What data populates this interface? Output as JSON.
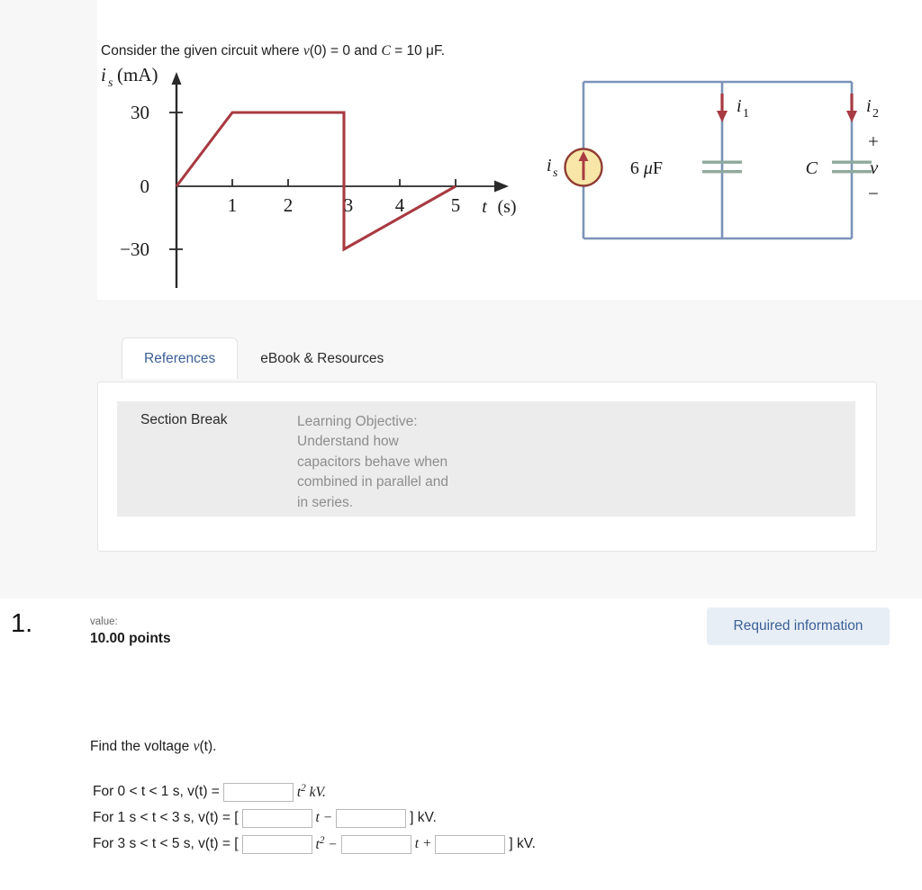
{
  "stimulus": {
    "prompt_prefix": "Consider the given circuit where ",
    "prompt_v0": "v",
    "prompt_mid": "(0) = 0 and ",
    "prompt_c": "C",
    "prompt_suffix": " = 10 μF."
  },
  "chart_data": {
    "type": "line",
    "title": "",
    "ylabel": "i_s (mA)",
    "ylabel_symbol": "i",
    "ylabel_sub": "s",
    "ylabel_unit": "(mA)",
    "xlabel": "t(s)",
    "xlabel_symbol": "t",
    "xlabel_unit": "(s)",
    "xlim": [
      0,
      5.6
    ],
    "ylim": [
      -45,
      42
    ],
    "xticks": [
      1,
      2,
      3,
      4,
      5
    ],
    "xtick_labels": [
      "1",
      "2",
      "3",
      "4",
      "5"
    ],
    "yticks": [
      30,
      0,
      -30
    ],
    "ytick_labels": [
      "30",
      "0",
      "−30"
    ],
    "grid": false,
    "legend": false,
    "series_color": "#a83a42",
    "series": [
      {
        "name": "i_s(t)",
        "points": [
          {
            "t": 0,
            "i": 0
          },
          {
            "t": 1,
            "i": 30
          },
          {
            "t": 3,
            "i": 30
          },
          {
            "t": 3,
            "i": -30
          },
          {
            "t": 5,
            "i": 0
          }
        ]
      }
    ],
    "description": "Piecewise source current: ramps 0 to 30 mA over 0<t<1 s, holds 30 mA for 1<t<3 s, steps down to -30 mA at t=3 s, then ramps linearly back to 0 at t=5 s."
  },
  "circuit": {
    "source_label": "i",
    "source_sub": "s",
    "branch1_current": "i",
    "branch1_sub": "1",
    "branch2_current": "i",
    "branch2_sub": "2",
    "cap1_label": "6 μF",
    "cap2_label": "C",
    "voltage_label": "v",
    "plus_sign": "+",
    "minus_sign": "−",
    "wire_color": "#7b93b8",
    "arrow_color": "#a83a42",
    "source_fill": "#f7e6a8",
    "plate_color": "#8fa99c"
  },
  "tabs": [
    {
      "label": "References",
      "active": true
    },
    {
      "label": "eBook & Resources",
      "active": false
    }
  ],
  "section_break": {
    "title": "Section Break",
    "objective": "Learning Objective: Understand how capacitors behave when combined in parallel and in series."
  },
  "question_header": {
    "number": "1.",
    "value_label": "value:",
    "points": "10.00 points",
    "required_button": "Required information"
  },
  "question": {
    "instruction_prefix": "Find the voltage ",
    "instruction_v": "v",
    "instruction_suffix": "(t).",
    "rows": [
      {
        "prefix": "For 0 < t < 1 s, v(t) = ",
        "lead_text": "For 0 < ",
        "after": " kV.",
        "inputs": [
          {
            "value": "",
            "placeholder": ""
          }
        ]
      },
      {
        "prefix": "For 1 s < t < 3 s, v(t) = [",
        "after": "] kV.",
        "inputs": [
          {
            "value": "",
            "placeholder": ""
          },
          {
            "value": "",
            "placeholder": ""
          }
        ]
      },
      {
        "prefix": "For 3 s < t < 5 s, v(t) = [",
        "after": "] kV.",
        "inputs": [
          {
            "value": "",
            "placeholder": ""
          },
          {
            "value": "",
            "placeholder": ""
          },
          {
            "value": "",
            "placeholder": ""
          }
        ]
      }
    ],
    "row1_full": "For 0 < t < 1 s, v(t) =",
    "row1_tail": "t² kV.",
    "row2_full": "For 1 s < t < 3 s, v(t) = [",
    "row2_mid": "t −",
    "row2_tail": "] kV.",
    "row3_full": "For 3 s < t < 5 s, v(t) = [",
    "row3_mid1": "t² −",
    "row3_mid2": "t +",
    "row3_tail": "] kV."
  },
  "colors": {
    "page_bg": "#f7f7f7",
    "panel_bg": "#ffffff",
    "accent_blue": "#3b6098",
    "badge_bg": "#e8eef5",
    "break_bg": "#ececec",
    "muted_text": "#8d8d8d"
  }
}
